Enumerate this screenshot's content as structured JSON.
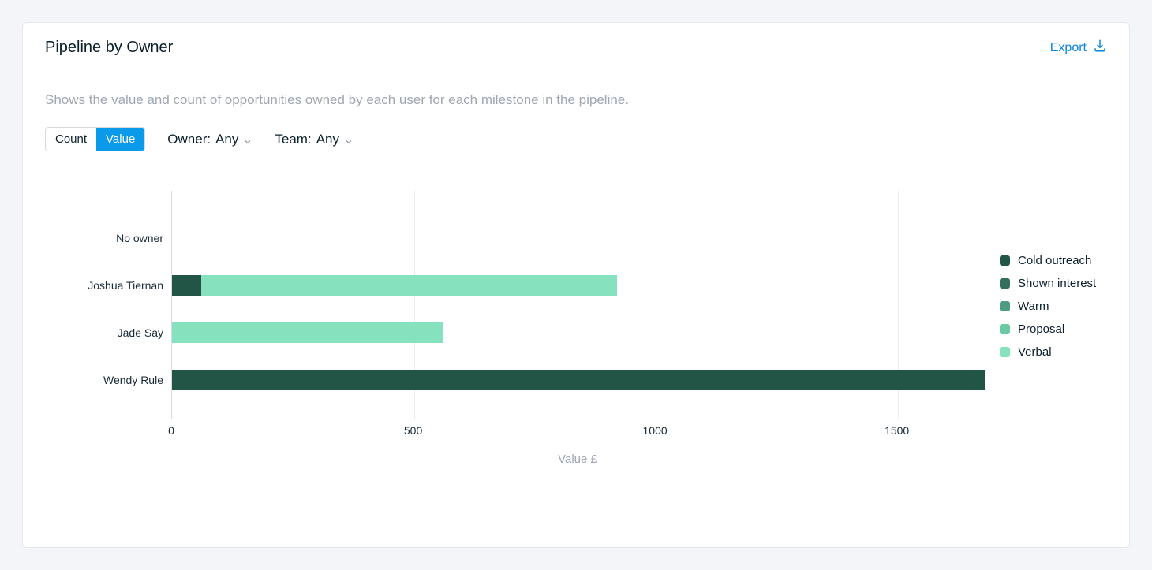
{
  "header": {
    "title": "Pipeline by Owner",
    "export_label": "Export"
  },
  "subtitle": "Shows the value and count of opportunities owned by each user for each milestone in the pipeline.",
  "controls": {
    "toggle": {
      "count_label": "Count",
      "value_label": "Value",
      "active": "Value"
    },
    "owner": {
      "label": "Owner:",
      "value": "Any"
    },
    "team": {
      "label": "Team:",
      "value": "Any"
    }
  },
  "chart_data": {
    "type": "bar",
    "orientation": "horizontal",
    "stacked": true,
    "categories": [
      "No owner",
      "Joshua Tiernan",
      "Jade Say",
      "Wendy Rule"
    ],
    "series": [
      {
        "name": "Cold outreach",
        "color": "#225546",
        "values": [
          0,
          60,
          0,
          1680
        ]
      },
      {
        "name": "Shown interest",
        "color": "#336f5c",
        "values": [
          0,
          0,
          0,
          0
        ]
      },
      {
        "name": "Warm",
        "color": "#4f9b80",
        "values": [
          0,
          0,
          0,
          0
        ]
      },
      {
        "name": "Proposal",
        "color": "#6bc9a4",
        "values": [
          0,
          0,
          0,
          0
        ]
      },
      {
        "name": "Verbal",
        "color": "#86e2be",
        "values": [
          0,
          860,
          560,
          0
        ]
      }
    ],
    "xlabel": "Value £",
    "xlim": [
      0,
      1680
    ],
    "xticks": [
      0,
      500,
      1000,
      1500
    ]
  }
}
